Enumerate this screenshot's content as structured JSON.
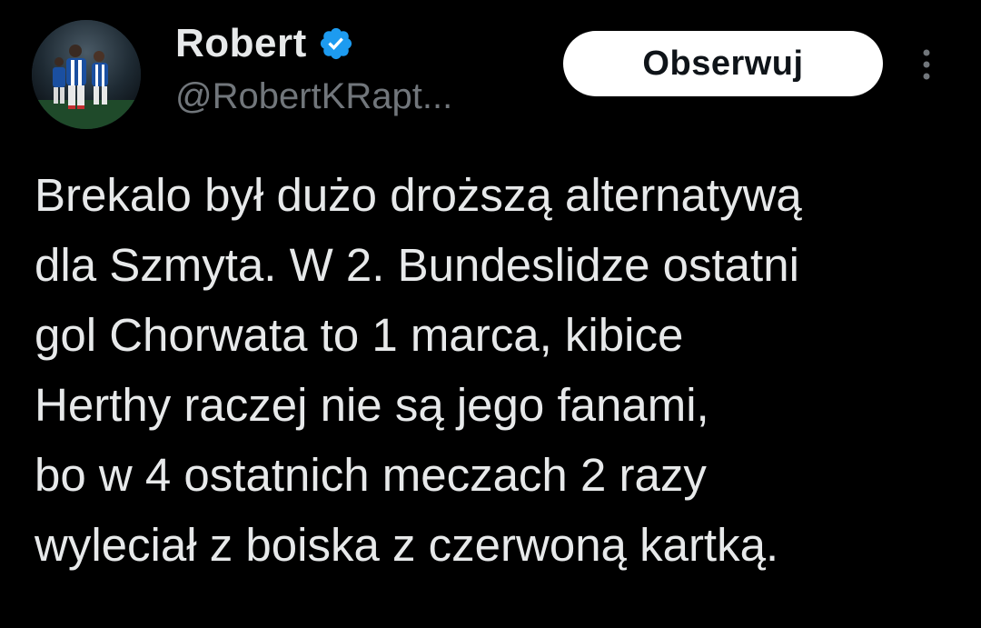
{
  "author": {
    "display_name": "Robert",
    "handle": "@RobertKRapt...",
    "verified_icon": "verified-badge-icon",
    "avatar_icon": "avatar-photo"
  },
  "actions": {
    "follow_label": "Obserwuj",
    "more_icon": "more-vertical-icon"
  },
  "tweet": {
    "lines": [
      "Brekalo był dużo droższą alternatywą",
      "dla Szmyta. W 2. Bundeslidze ostatni",
      "gol Chorwata to 1 marca, kibice",
      "Herthy raczej nie są jego fanami,",
      "bo w 4 ostatnich meczach 2 razy",
      "wyleciał z boiska z czerwoną kartką."
    ]
  },
  "colors": {
    "background": "#000000",
    "text_primary": "#e7e9ea",
    "text_secondary": "#71767b",
    "verified_blue": "#1d9bf0",
    "follow_bg": "#ffffff",
    "follow_text": "#0f1419"
  }
}
